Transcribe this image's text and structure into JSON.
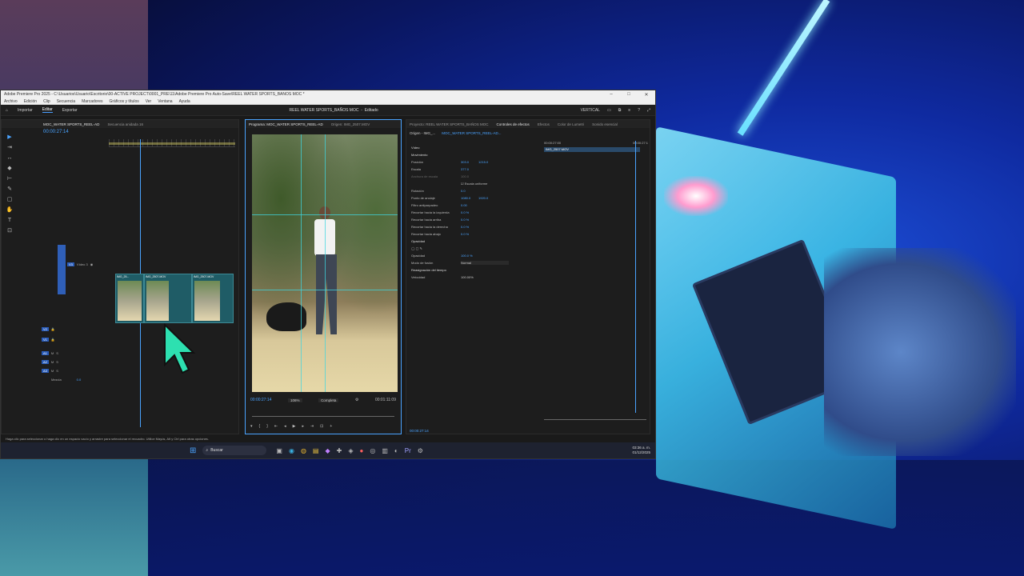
{
  "window": {
    "title": "Adobe Premiere Pro 2025 - C:\\Usuarios\\Usuario\\Escritorio\\00-ACTIVE PROJECT\\0001_PRE\\11\\Adobe Premiere Pro Auto-Save\\REEL WATER SPORTS_BAÑOS MOC *",
    "minimize": "–",
    "maximize": "□",
    "close": "✕"
  },
  "menu": [
    "Archivo",
    "Edición",
    "Clip",
    "Secuencia",
    "Marcadores",
    "Gráficos y títulos",
    "Ver",
    "Ventana",
    "Ayuda"
  ],
  "workspace": {
    "tabs": [
      "Importar",
      "Editar",
      "Exportar"
    ],
    "active_tab": "Editar",
    "project_name": "REEL WATER SPORTS_BAÑOS MOC",
    "project_status": "Editado",
    "layout_label": "VERTICAL"
  },
  "timeline": {
    "tabs": [
      "MOC_WATER SPORTS_REEL-AD",
      "Secuencia anidada 16"
    ],
    "timecode": "00:00:27:14",
    "tracks": [
      {
        "id": "V3",
        "label": "Vídeo 3"
      },
      {
        "id": "V2",
        "label": ""
      },
      {
        "id": "V1",
        "label": ""
      },
      {
        "id": "A1",
        "label": ""
      },
      {
        "id": "A2",
        "label": ""
      },
      {
        "id": "A3",
        "label": ""
      }
    ],
    "mix_label": "Mezcla",
    "mix_value": "0.0",
    "clips": [
      "IMG_25...",
      "IMG_2507.MOV",
      "IMG_2507.MOV"
    ]
  },
  "program": {
    "tabs": [
      "Programa: MOC_WATER SPORTS_REEL-AD",
      "Origen: IMG_2507.MOV"
    ],
    "timecode": "00:00:27:14",
    "zoom": "106%",
    "quality": "Completa",
    "duration": "00:01:11:09"
  },
  "effects": {
    "tabs": [
      "Proyecto: REEL WATER SPORTS_BAÑOS MOC",
      "Controles de efectos",
      "Efectos",
      "Color de Lumetri",
      "Sonido esencial"
    ],
    "source_label": "Origen - IMG_...",
    "sequence_label": "MOC_WATER SPORTS_REEL-AD...",
    "section_video": "Vídeo",
    "clip_name": "IMG_2507.MOV",
    "ruler_start": "00:00:27:00",
    "ruler_end": "00:00:27:1",
    "rows": [
      {
        "name": "Movimiento",
        "v1": "",
        "v2": "",
        "type": "sec"
      },
      {
        "name": "Posición",
        "v1": "303.0",
        "v2": "1215.0",
        "type": "row"
      },
      {
        "name": "Escala",
        "v1": "377.0",
        "v2": "",
        "type": "row"
      },
      {
        "name": "Anchura de escala",
        "v1": "100.0",
        "v2": "",
        "type": "dim"
      },
      {
        "name": "",
        "v1": "Escala uniforme",
        "v2": "",
        "type": "row"
      },
      {
        "name": "Rotación",
        "v1": "0.0",
        "v2": "",
        "type": "row"
      },
      {
        "name": "Punto de anclaje",
        "v1": "1080.0",
        "v2": "1920.0",
        "type": "row"
      },
      {
        "name": "Filtro antiparpadeo",
        "v1": "0.00",
        "v2": "",
        "type": "row"
      },
      {
        "name": "Recortar hacia la izquierda",
        "v1": "0.0 %",
        "v2": "",
        "type": "row"
      },
      {
        "name": "Recortar hacia arriba",
        "v1": "0.0 %",
        "v2": "",
        "type": "row"
      },
      {
        "name": "Recortar hacia la derecha",
        "v1": "0.0 %",
        "v2": "",
        "type": "row"
      },
      {
        "name": "Recortar hacia abajo",
        "v1": "0.0 %",
        "v2": "",
        "type": "row"
      },
      {
        "name": "Opacidad",
        "v1": "",
        "v2": "",
        "type": "sec"
      },
      {
        "name": "",
        "v1": "",
        "v2": "",
        "type": "row"
      },
      {
        "name": "Opacidad",
        "v1": "100.0 %",
        "v2": "",
        "type": "row"
      },
      {
        "name": "Modo de fusión",
        "v1": "Normal",
        "v2": "",
        "type": "row"
      },
      {
        "name": "Reasignación del tiempo",
        "v1": "",
        "v2": "",
        "type": "sec"
      },
      {
        "name": "Velocidad",
        "v1": "100.00%",
        "v2": "",
        "type": "row"
      }
    ],
    "timecode": "00:00:27:14"
  },
  "status": {
    "message": "Haga clic para seleccionar o haga clic en un espacio vacío y arrastre para seleccionar el recuadro. Utilice Mayús, Alt y Ctrl para otras opciones."
  },
  "taskbar": {
    "search_placeholder": "Buscar",
    "time": "03:36 a. m.",
    "date": "01/12/2025"
  },
  "colors": {
    "accent": "#4aa3ff",
    "guide": "#3fd6e0",
    "cursor": "#2de0b0"
  }
}
